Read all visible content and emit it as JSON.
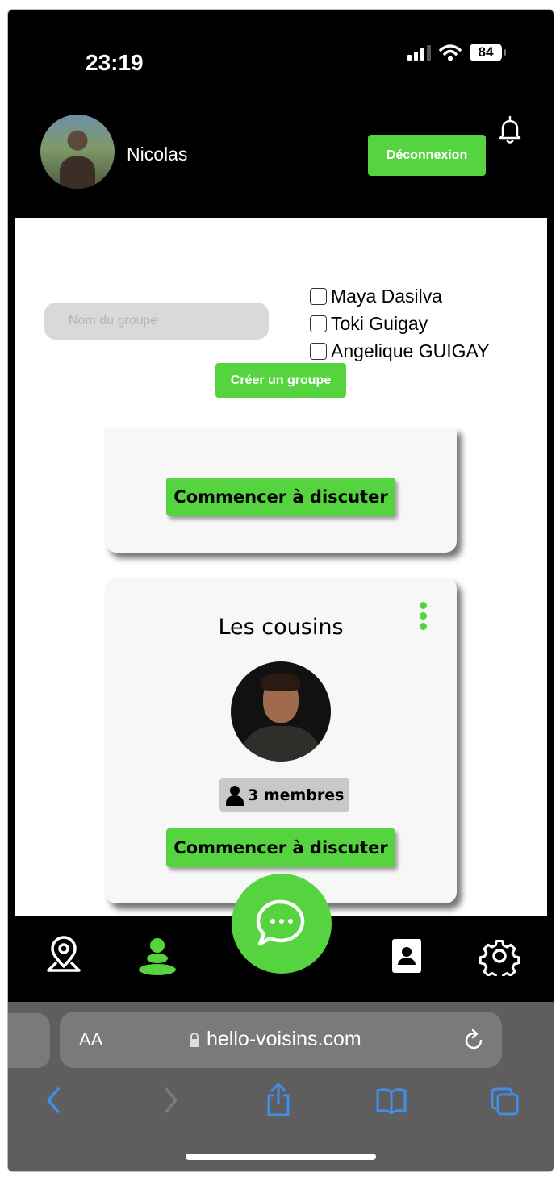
{
  "status_bar": {
    "time": "23:19",
    "battery": "84"
  },
  "header": {
    "user_name": "Nicolas",
    "logout_label": "Déconnexion"
  },
  "create_group": {
    "name_placeholder": "Nom du groupe",
    "members": [
      {
        "name": "Maya Dasilva",
        "checked": false
      },
      {
        "name": "Toki Guigay",
        "checked": false
      },
      {
        "name": "Angelique GUIGAY",
        "checked": false
      }
    ],
    "create_label": "Créer un groupe"
  },
  "groups": [
    {
      "chat_label": "Commencer à discuter"
    },
    {
      "title": "Les cousins",
      "members_count": "3 membres",
      "chat_label": "Commencer à discuter"
    }
  ],
  "bottom_nav": {
    "icons": [
      "map-pin-icon",
      "groups-icon",
      "chat-bubble-icon",
      "contact-card-icon",
      "settings-gear-icon"
    ],
    "active": "groups-icon"
  },
  "browser": {
    "text_size_label": "AA",
    "url": "hello-voisins.com"
  },
  "colors": {
    "accent": "#56d440",
    "header_bg": "#000000",
    "card_bg": "#f7f7f7",
    "browser_bg": "#5e5e5e"
  }
}
